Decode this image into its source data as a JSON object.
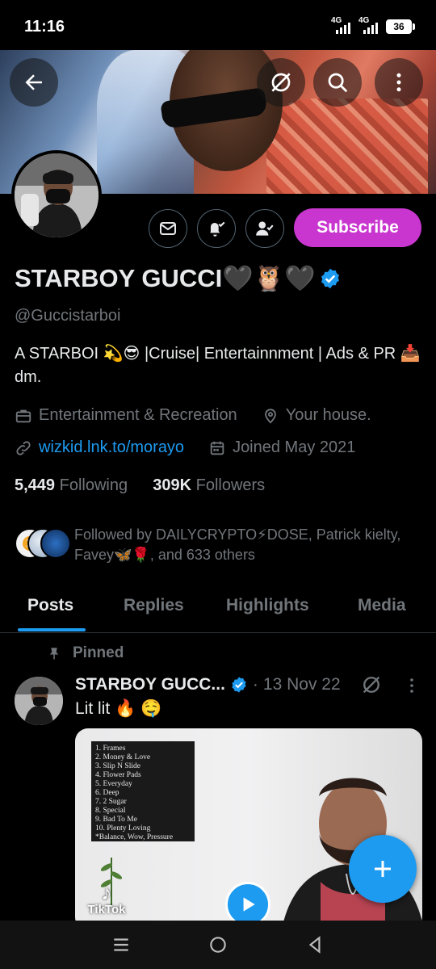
{
  "status_bar": {
    "time": "11:16",
    "network1": "4G",
    "network2": "4G",
    "battery": "36"
  },
  "profile": {
    "display_name": "STARBOY GUCCI🖤🦉🖤",
    "handle": "@Guccistarboi",
    "bio": "A STARBOI 💫😎 |Cruise| Entertainnment | Ads & PR 📥 dm.",
    "category": "Entertainment & Recreation",
    "location": "Your house.",
    "website": "wizkid.lnk.to/morayo",
    "joined": "Joined May 2021",
    "following_count": "5,449",
    "following_label": "Following",
    "followers_count": "309K",
    "followers_label": "Followers",
    "followed_by": "Followed by DAILYCRYPTO⚡DOSE, Patrick kielty, Favey🦋🌹, and 633 others",
    "subscribe_label": "Subscribe"
  },
  "tabs": [
    {
      "label": "Posts",
      "active": true
    },
    {
      "label": "Replies",
      "active": false
    },
    {
      "label": "Highlights",
      "active": false
    },
    {
      "label": "Media",
      "active": false
    }
  ],
  "post": {
    "pinned_label": "Pinned",
    "author": "STARBOY GUCC...",
    "separator": "·",
    "date": "13 Nov 22",
    "text": "Lit lit 🔥 🤤",
    "media": {
      "tracklist": [
        "1. Frames",
        "2. Money & Love",
        "3. Slip N Slide",
        "4. Flower Pads",
        "5. Everyday",
        "6. Deep",
        "7. 2 Sugar",
        "8. Special",
        "9. Bad To Me",
        "10. Plenty Loving",
        "*Balance, Wow, Pressure"
      ],
      "watermark": "TikTok"
    }
  },
  "icons": {
    "back": "arrow-left-icon",
    "grok": "grok-icon",
    "search": "search-icon",
    "more": "more-vertical-icon",
    "message": "envelope-icon",
    "notify": "bell-check-icon",
    "follow": "person-check-icon",
    "briefcase": "briefcase-icon",
    "location": "location-pin-icon",
    "link": "link-icon",
    "calendar": "calendar-icon",
    "verified": "verified-badge-icon",
    "pin": "pin-icon",
    "compose": "plus-icon"
  },
  "colors": {
    "accent": "#1d9bf0",
    "subscribe": "#c936cf",
    "muted": "#71767b",
    "background": "#000000"
  }
}
